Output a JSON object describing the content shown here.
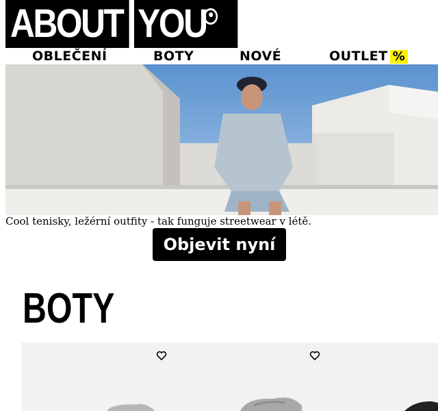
{
  "header": {
    "logo_part1": "ABOUT",
    "logo_part2": "YOU"
  },
  "nav": {
    "items": [
      {
        "label": "OBLEČENÍ"
      },
      {
        "label": "BOTY"
      },
      {
        "label": "NOVÉ"
      },
      {
        "label": "OUTLET",
        "badge": "%"
      }
    ],
    "badge_color": "#fff000"
  },
  "hero": {
    "caption": "Cool tenisky, ležérní outfity - tak funguje streetwear v létě.",
    "cta_label": "Objevit nyní"
  },
  "section": {
    "title": "BOTY",
    "favorite_icon": "heart-icon"
  }
}
